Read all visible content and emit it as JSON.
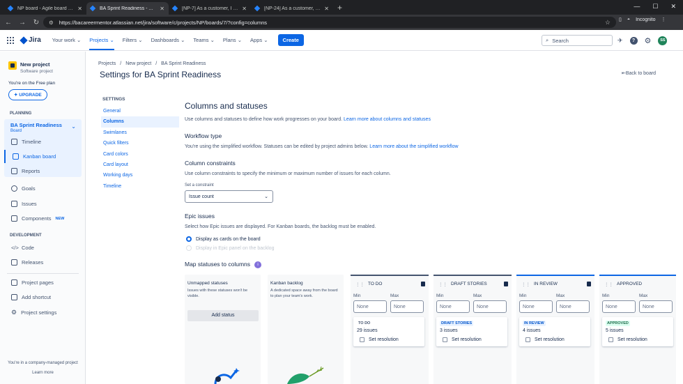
{
  "browser": {
    "tabs": [
      {
        "title": "NP board - Agile board - Jira",
        "active": false
      },
      {
        "title": "BA Sprint Readiness - Agile Bo...",
        "active": true
      },
      {
        "title": "[NP-7] As a customer, I want to...",
        "active": false
      },
      {
        "title": "[NP-24] As a customer, I want t...",
        "active": false
      }
    ],
    "new_tab": "+",
    "url": "https://bacareermentor.atlassian.net/jira/software/c/projects/NP/boards/7/?config=columns",
    "profile": "Incognito"
  },
  "topnav": {
    "product": "Jira",
    "items": [
      "Your work",
      "Projects",
      "Filters",
      "Dashboards",
      "Teams",
      "Plans",
      "Apps"
    ],
    "selected": "Projects",
    "create": "Create",
    "search_placeholder": "Search",
    "avatar_initials": "SS"
  },
  "sidebar": {
    "project_name": "New project",
    "project_type": "Software project",
    "plan": "You're on the Free plan",
    "upgrade": "UPGRADE",
    "planning_heading": "PLANNING",
    "board_name": "BA Sprint Readiness",
    "board_type": "Board",
    "board_items": [
      "Timeline",
      "Kanban board",
      "Reports"
    ],
    "items": [
      "Goals",
      "Issues",
      "Components"
    ],
    "new_badge": "NEW",
    "development_heading": "DEVELOPMENT",
    "dev_items": [
      "Code",
      "Releases"
    ],
    "bottom_items": [
      "Project pages",
      "Add shortcut",
      "Project settings"
    ],
    "footer_text": "You're in a company-managed project",
    "footer_link": "Learn more"
  },
  "header": {
    "breadcrumbs": [
      "Projects",
      "/",
      "New project",
      "/",
      "BA Sprint Readiness"
    ],
    "title": "Settings for BA Sprint Readiness",
    "back": "Back to board"
  },
  "settings_nav": {
    "heading": "SETTINGS",
    "items": [
      "General",
      "Columns",
      "Swimlanes",
      "Quick filters",
      "Card colors",
      "Card layout",
      "Working days",
      "Timeline"
    ],
    "selected": "Columns"
  },
  "content": {
    "title": "Columns and statuses",
    "intro": "Use columns and statuses to define how work progresses on your board.",
    "intro_link": "Learn more about columns and statuses",
    "workflow_title": "Workflow type",
    "workflow_text": "You're using the simplified workflow. Statuses can be edited by project admins below.",
    "workflow_link": "Learn more about the simplified workflow",
    "constraints_title": "Column constraints",
    "constraints_text": "Use column constraints to specify the minimum or maximum number of issues for each column.",
    "constraint_label": "Set a constraint",
    "constraint_value": "Issue count",
    "epic_title": "Epic issues",
    "epic_text": "Select how Epic issues are displayed. For Kanban boards, the backlog must be enabled.",
    "epic_option_1": "Display as cards on the board",
    "epic_option_2": "Display in Epic panel on the backlog",
    "map_title": "Map statuses to columns",
    "map_info": "i"
  },
  "unmapped": {
    "title": "Unmapped statuses",
    "desc": "Issues with these statuses won't be visible.",
    "button": "Add status"
  },
  "backlog": {
    "title": "Kanban backlog",
    "desc": "A dedicated space away from the board to plan your team's work."
  },
  "columns": [
    {
      "name": "TO DO",
      "min_label": "Min",
      "max_label": "Max",
      "min": "None",
      "max": "None",
      "status": "TO DO",
      "count": "29 issues",
      "resolution": "Set resolution",
      "color": "#44546f"
    },
    {
      "name": "DRAFT STORIES",
      "min_label": "Min",
      "max_label": "Max",
      "min": "None",
      "max": "None",
      "status": "DRAFT STORIES",
      "count": "3 issues",
      "resolution": "Set resolution",
      "color": "#44546f"
    },
    {
      "name": "IN REVIEW",
      "min_label": "Min",
      "max_label": "Max",
      "min": "None",
      "max": "None",
      "status": "IN REVIEW",
      "count": "4 issues",
      "resolution": "Set resolution",
      "color": "#0c66e4"
    },
    {
      "name": "APPROVED",
      "min_label": "Min",
      "max_label": "Max",
      "min": "None",
      "max": "None",
      "status": "APPROVED",
      "count": "5 issues",
      "resolution": "Set resolution",
      "color": "#0c66e4"
    }
  ],
  "colors": {
    "accent": "#0c66e4",
    "brand": "#0052cc"
  }
}
